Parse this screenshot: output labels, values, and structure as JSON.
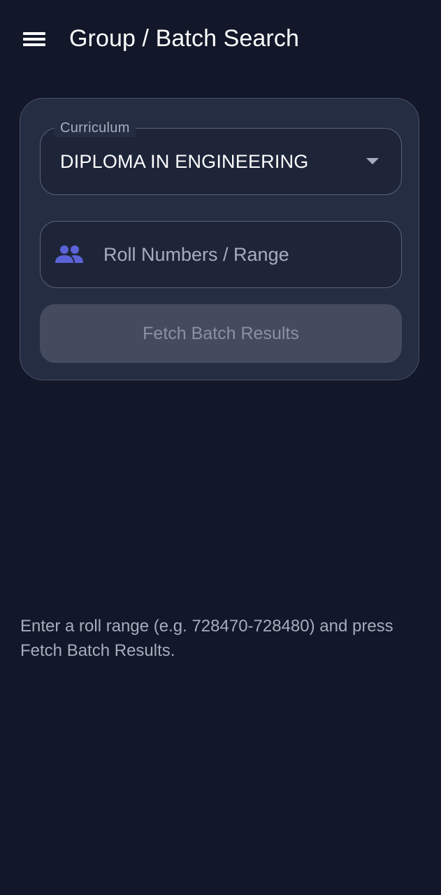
{
  "appbar": {
    "menu_icon": "hamburger-menu-icon",
    "title": "Group / Batch Search"
  },
  "form": {
    "curriculum": {
      "label": "Curriculum",
      "value": "DIPLOMA IN ENGINEERING",
      "arrow_icon": "dropdown-arrow-icon"
    },
    "roll_input": {
      "icon": "people-icon",
      "placeholder": "Roll Numbers / Range",
      "value": ""
    },
    "fetch_button": {
      "label": "Fetch Batch Results",
      "enabled": false
    }
  },
  "hint": "Enter a roll range (e.g. 728470-728480) and press Fetch Batch Results.",
  "colors": {
    "background": "#121729",
    "card": "#252d42",
    "accent_icon": "#5b63d6",
    "button_disabled": "#444b5e",
    "text_primary": "#ffffff",
    "text_secondary": "#a6adbd"
  }
}
